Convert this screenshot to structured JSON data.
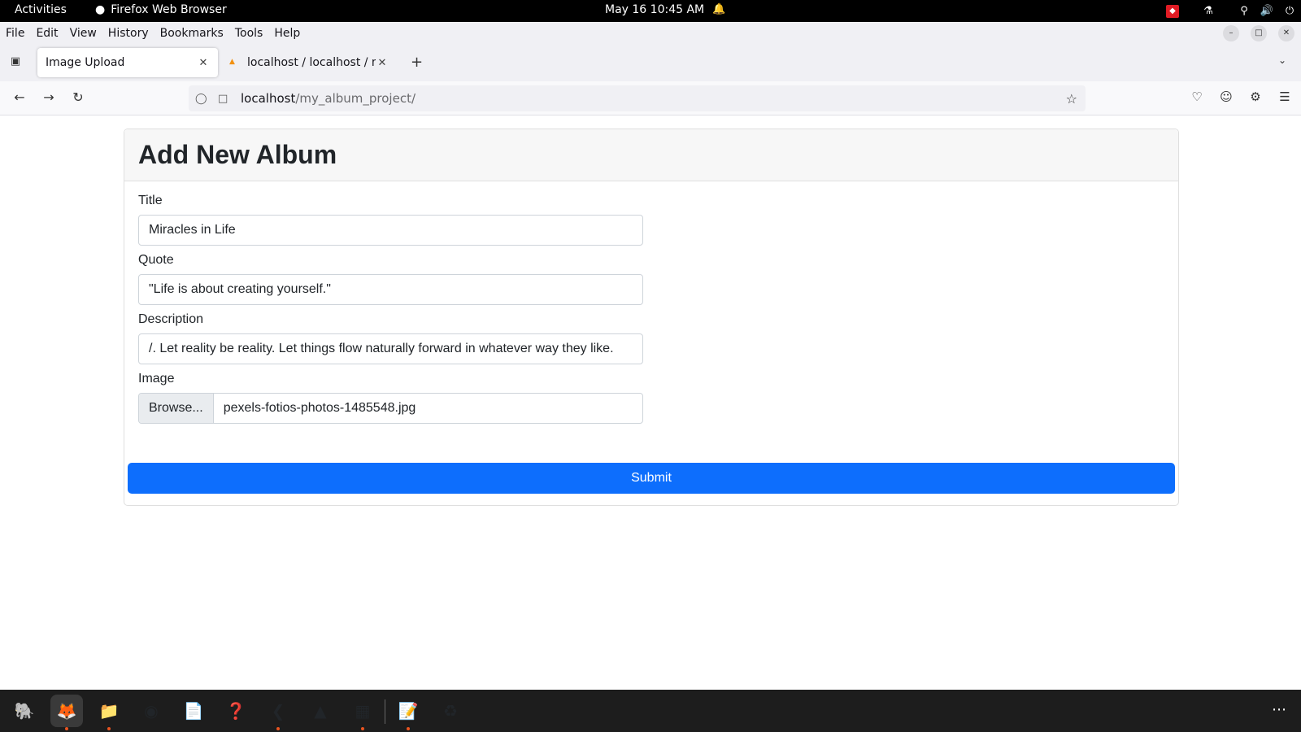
{
  "system": {
    "activities": "Activities",
    "app_name": "Firefox Web Browser",
    "clock": "May 16  10:45 AM"
  },
  "browser": {
    "menu": [
      "File",
      "Edit",
      "View",
      "History",
      "Bookmarks",
      "Tools",
      "Help"
    ],
    "tabs": [
      {
        "title": "Image Upload"
      },
      {
        "title": "localhost / localhost / my"
      }
    ],
    "url_host": "localhost",
    "url_path": "/my_album_project/"
  },
  "page": {
    "heading": "Add New Album",
    "fields": {
      "title": {
        "label": "Title",
        "value": "Miracles in Life"
      },
      "quote": {
        "label": "Quote",
        "value": "\"Life is about creating yourself.\""
      },
      "description": {
        "label": "Description",
        "value": "/. Let reality be reality. Let things flow naturally forward in whatever way they like."
      },
      "image": {
        "label": "Image",
        "browse_label": "Browse...",
        "file_name": "pexels-fotios-photos-1485548.jpg"
      }
    },
    "submit_label": "Submit"
  },
  "colors": {
    "primary_button": "#0d6efd",
    "top_bar": "#000000",
    "dock": "#1d1d1d"
  }
}
